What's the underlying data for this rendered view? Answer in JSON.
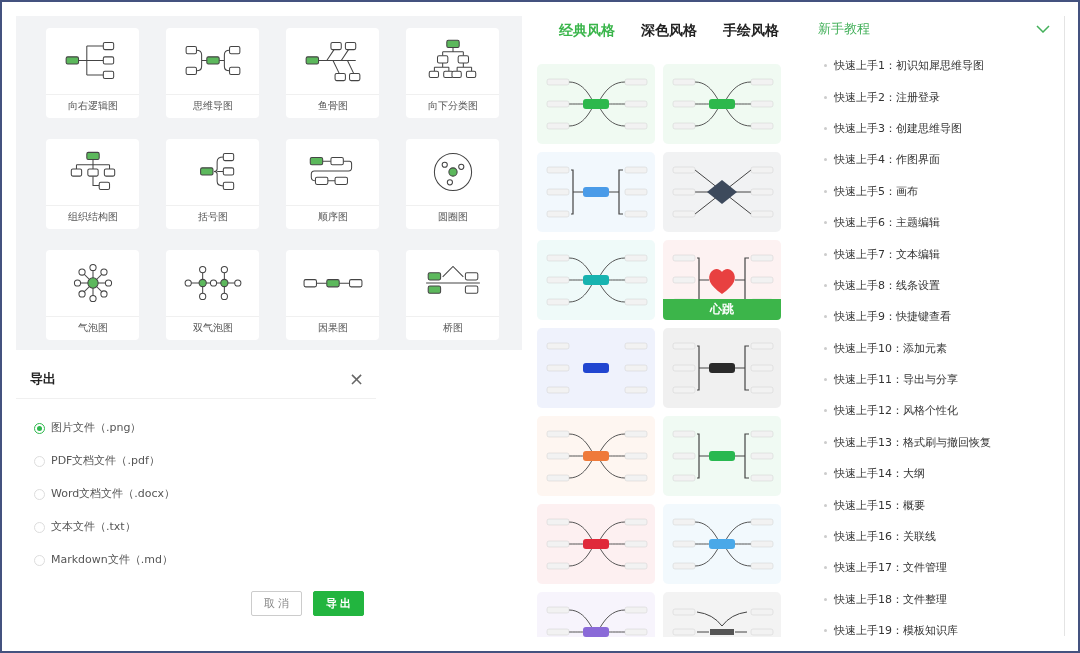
{
  "diagram_types": [
    {
      "kind": "right-tree",
      "label": "向右逻辑图"
    },
    {
      "kind": "mind-map",
      "label": "思维导图"
    },
    {
      "kind": "fishbone",
      "label": "鱼骨图"
    },
    {
      "kind": "down-tree",
      "label": "向下分类图"
    },
    {
      "kind": "org-chart",
      "label": "组织结构图"
    },
    {
      "kind": "brace",
      "label": "括号图"
    },
    {
      "kind": "sequence",
      "label": "顺序图"
    },
    {
      "kind": "circle",
      "label": "圆圈图"
    },
    {
      "kind": "bubble",
      "label": "气泡图"
    },
    {
      "kind": "double-bubble",
      "label": "双气泡图"
    },
    {
      "kind": "cause",
      "label": "因果图"
    },
    {
      "kind": "bridge",
      "label": "桥图"
    }
  ],
  "export_dialog": {
    "title": "导出",
    "close": "×",
    "options": [
      {
        "label": "图片文件（.png）",
        "selected": true
      },
      {
        "label": "PDF文档文件（.pdf）",
        "selected": false
      },
      {
        "label": "Word文档文件（.docx）",
        "selected": false
      },
      {
        "label": "文本文件（.txt）",
        "selected": false
      },
      {
        "label": "Markdown文件（.md）",
        "selected": false
      }
    ],
    "buttons": [
      {
        "label": "取 消",
        "kind": "secondary"
      },
      {
        "label": "导 出",
        "kind": "primary"
      }
    ]
  },
  "style_tabs": [
    {
      "label": "经典风格",
      "selected": true
    },
    {
      "label": "深色风格",
      "selected": false
    },
    {
      "label": "手绘风格",
      "selected": false
    }
  ],
  "style_templates": [
    {
      "kind": "curve",
      "color": "#2db84c"
    },
    {
      "kind": "curve",
      "color": "#2db84c"
    },
    {
      "kind": "bracket",
      "color": "#4a9be8"
    },
    {
      "kind": "diamond",
      "color": "#3d4a5c"
    },
    {
      "kind": "curve",
      "color": "#17b3b0"
    },
    {
      "kind": "heart",
      "color": "#e84040",
      "banner": "心跳"
    },
    {
      "kind": "plain",
      "color": "#2146d0"
    },
    {
      "kind": "bracket",
      "color": "#2a2a2a"
    },
    {
      "kind": "curve",
      "color": "#ef7a3a"
    },
    {
      "kind": "bracket",
      "color": "#28b850"
    },
    {
      "kind": "curve",
      "color": "#e02a3a"
    },
    {
      "kind": "curve",
      "color": "#4aa8e8"
    },
    {
      "kind": "curve",
      "color": "#8a6ad8"
    },
    {
      "kind": "line",
      "color": "#555555"
    }
  ],
  "tutorial": {
    "title": "新手教程",
    "expanded": true,
    "items": [
      "快速上手1：初识知犀思维导图",
      "快速上手2：注册登录",
      "快速上手3：创建思维导图",
      "快速上手4：作图界面",
      "快速上手5：画布",
      "快速上手6：主题编辑",
      "快速上手7：文本编辑",
      "快速上手8：线条设置",
      "快速上手9：快捷键查看",
      "快速上手10：添加元素",
      "快速上手11：导出与分享",
      "快速上手12：风格个性化",
      "快速上手13：格式刷与撤回恢复",
      "快速上手14：大纲",
      "快速上手15：概要",
      "快速上手16：关联线",
      "快速上手17：文件管理",
      "快速上手18：文件整理",
      "快速上手19：模板知识库"
    ]
  }
}
